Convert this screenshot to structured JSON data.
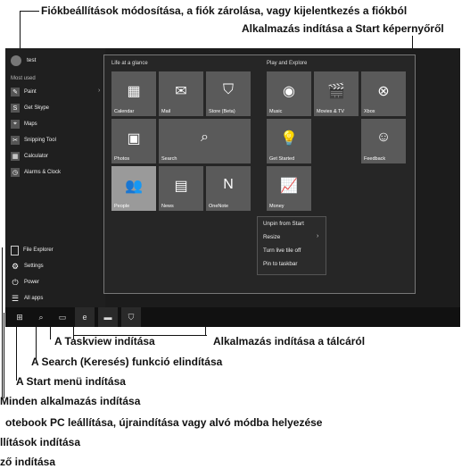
{
  "callouts": {
    "account": "Fiókbeállítások módosítása, a fiók zárolása, vagy kijelentkezés a fiókból",
    "start_screen": "Alkalmazás indítása a Start képernyőről",
    "taskview": "A Taskview indítása",
    "taskbar_app": "Alkalmazás indítása a tálcáról",
    "search": "A Search (Keresés) funkció elindítása",
    "start_menu": "A Start menü indítása",
    "all_apps": "Minden alkalmazás indítása",
    "power": "otebook PC leállítása, újraindítása vagy alvó módba helyezése",
    "settings": "llítások indítása",
    "explorer": "ző indítása"
  },
  "start": {
    "user": "test",
    "most_used": "Most used",
    "apps": [
      {
        "label": "Paint",
        "icon": "paint-icon"
      },
      {
        "label": "Get Skype",
        "icon": "skype-icon"
      },
      {
        "label": "Maps",
        "icon": "maps-icon"
      },
      {
        "label": "Snipping Tool",
        "icon": "scissors-icon"
      },
      {
        "label": "Calculator",
        "icon": "calculator-icon"
      },
      {
        "label": "Alarms & Clock",
        "icon": "alarm-icon"
      }
    ],
    "file_explorer": "File Explorer",
    "settings": "Settings",
    "power": "Power",
    "all_apps": "All apps",
    "groups": {
      "glance": "Life at a glance",
      "play": "Play and Explore"
    },
    "tiles": {
      "calendar": "Calendar",
      "mail": "Mail",
      "store": "Store (Beta)",
      "music": "Music",
      "movies": "Movies & TV",
      "xbox": "Xbox",
      "photos": "Photos",
      "search": "Search",
      "get_started": "Get Started",
      "feedback": "Feedback",
      "people": "People",
      "news": "News",
      "onenote": "OneNote",
      "money": "Money"
    },
    "context_menu": [
      "Unpin from Start",
      "Resize",
      "Turn live tile off",
      "Pin to taskbar"
    ]
  },
  "colors": {
    "background": "#1c1c1c",
    "tile": "#5a5a5a",
    "text": "#111111"
  }
}
